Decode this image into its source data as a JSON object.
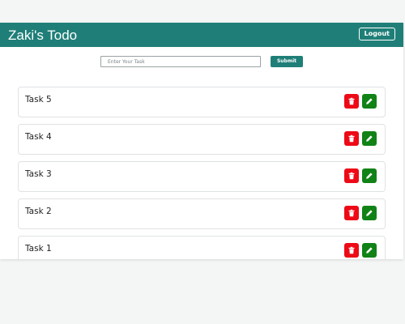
{
  "app": {
    "title": "Zaki's Todo",
    "logout_label": "Logout"
  },
  "form": {
    "placeholder": "Enter Your Task",
    "value": "",
    "submit_label": "Submit"
  },
  "tasks": [
    {
      "label": "Task 5",
      "delete_icon": "trash-icon",
      "edit_icon": "pencil-icon"
    },
    {
      "label": "Task 4",
      "delete_icon": "trash-icon",
      "edit_icon": "pencil-icon"
    },
    {
      "label": "Task 3",
      "delete_icon": "trash-icon",
      "edit_icon": "pencil-icon"
    },
    {
      "label": "Task 2",
      "delete_icon": "trash-icon",
      "edit_icon": "pencil-icon"
    },
    {
      "label": "Task 1",
      "delete_icon": "trash-icon",
      "edit_icon": "pencil-icon"
    }
  ],
  "colors": {
    "primary": "#1f7f78",
    "delete": "#ed0a16",
    "edit": "#118216",
    "background": "#f4f5f5"
  }
}
